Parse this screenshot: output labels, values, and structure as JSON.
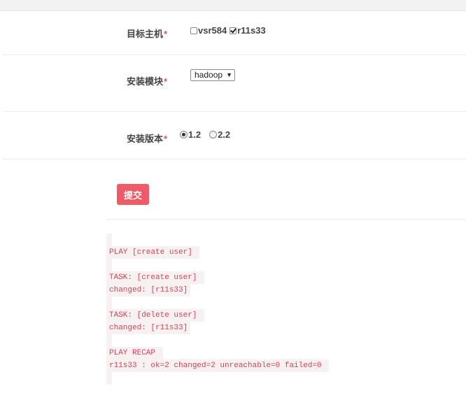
{
  "form": {
    "target_host": {
      "label": "目标主机",
      "required": "*",
      "options": [
        {
          "label": "vsr584",
          "checked": false
        },
        {
          "label": "r11s33",
          "checked": true
        }
      ]
    },
    "install_module": {
      "label": "安装模块",
      "required": "*",
      "selected": "hadoop"
    },
    "install_version": {
      "label": "安装版本",
      "required": "*",
      "options": [
        {
          "label": "1.2",
          "selected": true
        },
        {
          "label": "2.2",
          "selected": false
        }
      ]
    },
    "submit_label": "提交"
  },
  "output": {
    "lines": [
      "",
      "PLAY [create user] ",
      "",
      "TASK: [create user] ",
      "changed: [r11s33]",
      "",
      "TASK: [delete user] ",
      "changed: [r11s33]",
      "",
      "PLAY RECAP ",
      "r11s33 : ok=2 changed=2 unreachable=0 failed=0 ",
      ""
    ]
  }
}
